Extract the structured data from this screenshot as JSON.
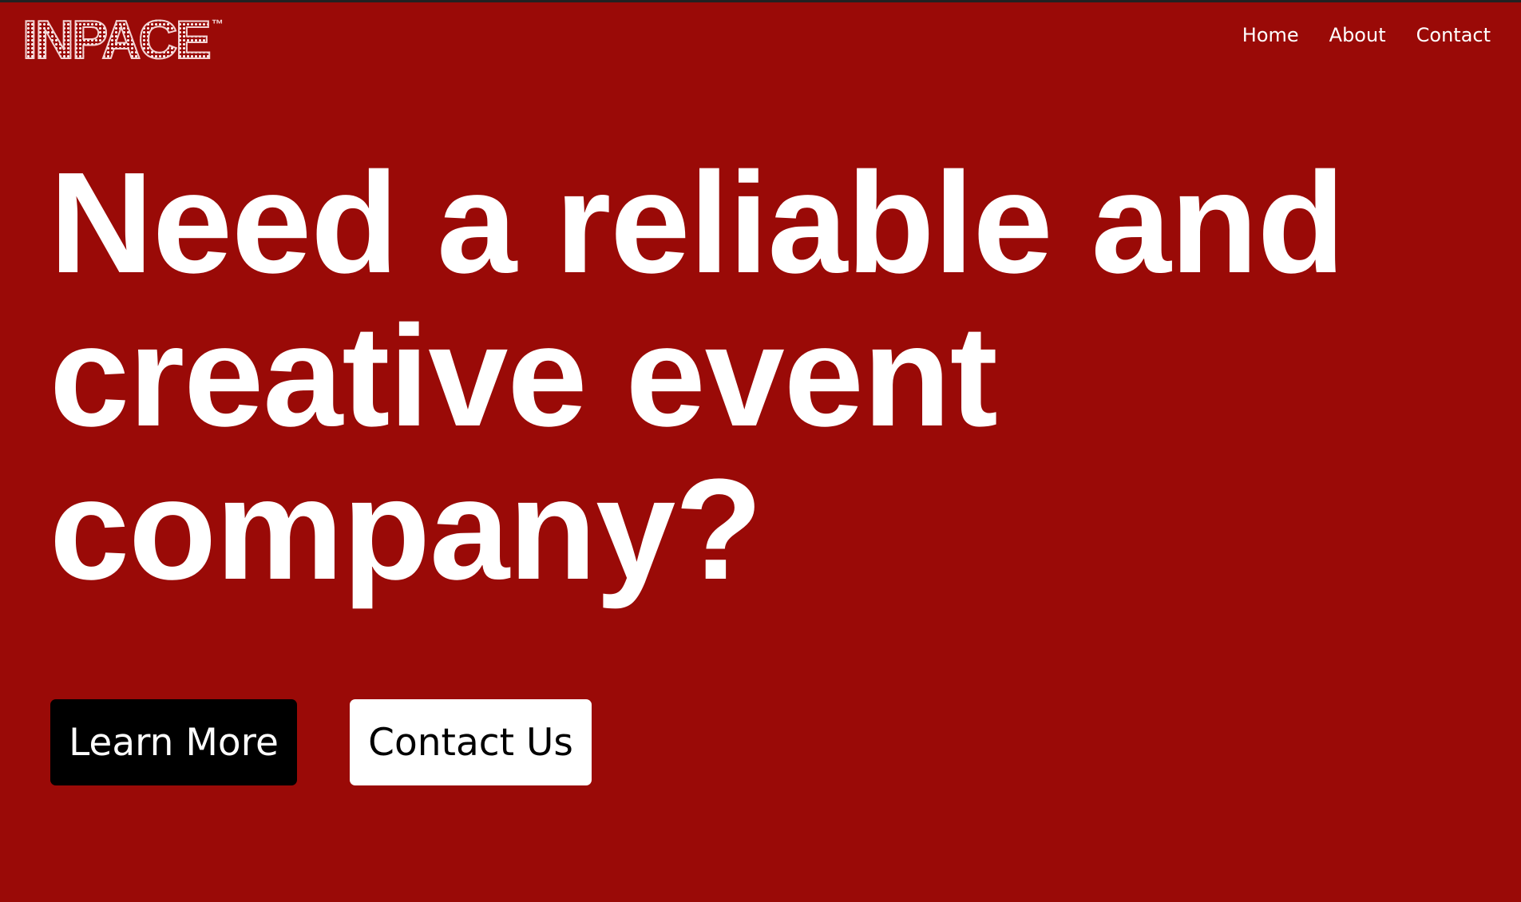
{
  "header": {
    "logo_text": "INPACE",
    "logo_tm": "™",
    "nav": [
      {
        "label": "Home"
      },
      {
        "label": "About"
      },
      {
        "label": "Contact"
      }
    ]
  },
  "hero": {
    "title": "Need a reliable and creative event company?",
    "primary_button": "Learn More",
    "secondary_button": "Contact Us"
  },
  "colors": {
    "background": "#9a0a07",
    "text": "#ffffff",
    "primary_button_bg": "#000000",
    "secondary_button_bg": "#ffffff"
  }
}
